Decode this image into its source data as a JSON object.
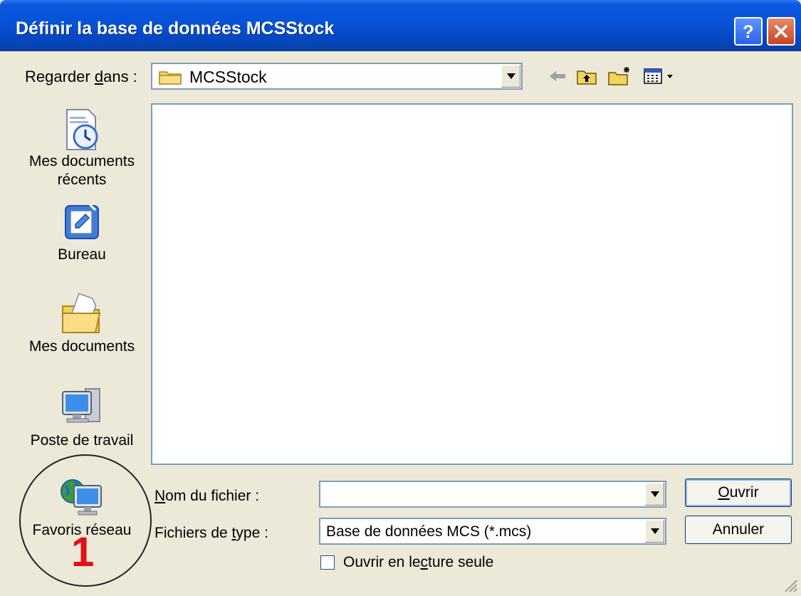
{
  "window": {
    "title": "Définir la base de données MCSStock",
    "help_icon": "help-icon",
    "close_icon": "close-icon"
  },
  "look_in": {
    "label_pre": "Regarder ",
    "label_underline": "d",
    "label_post": "ans :",
    "value": "MCSStock",
    "icon": "folder-icon"
  },
  "toolbar": {
    "icons": [
      "back-arrow-icon",
      "up-folder-icon",
      "new-folder-icon",
      "view-menu-icon"
    ]
  },
  "places": [
    {
      "label_line1": "Mes documents",
      "label_line2": "récents",
      "icon": "recent-documents-icon"
    },
    {
      "label_line1": "Bureau",
      "label_line2": "",
      "icon": "desktop-icon"
    },
    {
      "label_line1": "Mes documents",
      "label_line2": "",
      "icon": "my-documents-icon"
    },
    {
      "label_line1": "Poste de travail",
      "label_line2": "",
      "icon": "my-computer-icon"
    },
    {
      "label_line1": "Favoris réseau",
      "label_line2": "",
      "icon": "network-places-icon"
    }
  ],
  "form": {
    "filename": {
      "label_underline": "N",
      "label_rest": "om du fichier :",
      "value": ""
    },
    "filetype": {
      "label_pre": "Fichiers de ",
      "label_underline": "t",
      "label_post": "ype :",
      "value": "Base de données MCS (*.mcs)"
    },
    "readonly": {
      "label_pre": "Ouvrir en le",
      "label_underline": "c",
      "label_post": "ture seule",
      "checked": false
    }
  },
  "buttons": {
    "open_underline": "O",
    "open_rest": "uvrir",
    "cancel": "Annuler"
  },
  "annotation": {
    "number": "1",
    "color": "#e11212"
  }
}
